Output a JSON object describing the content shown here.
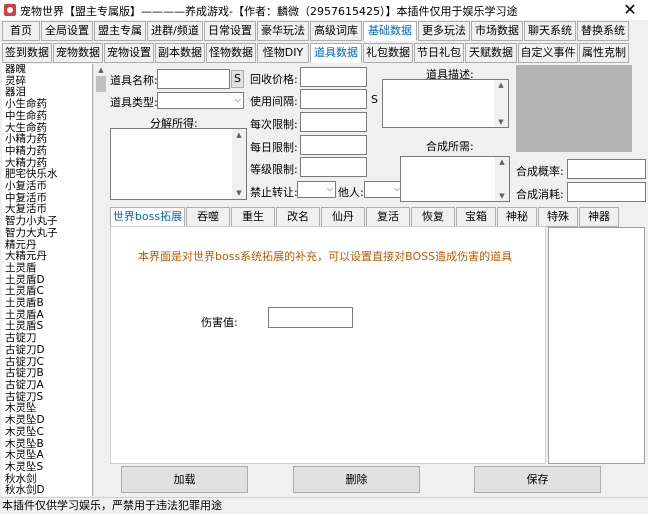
{
  "window": {
    "title": "宠物世界【盟主专属版】————养成游戏-【作者：麟微（2957615425）】本插件仅用于娱乐学习途",
    "close_glyph": "✕"
  },
  "top_tabs": [
    "首页",
    "全局设置",
    "盟主专属",
    "进群/频道",
    "日常设置",
    "豪华玩法",
    "高级词库",
    "基础数据",
    "更多玩法",
    "市场数据",
    "聊天系统",
    "替换系统"
  ],
  "second_tabs": [
    "签到数据",
    "宠物数据",
    "宠物设置",
    "副本数据",
    "怪物数据",
    "怪物DIY",
    "道具数据",
    "礼包数据",
    "节日礼包",
    "天赋数据",
    "自定义事件",
    "属性克制"
  ],
  "item_list": [
    "器魄",
    "灵碎",
    "器泪",
    "小生命药",
    "中生命药",
    "大生命药",
    "小精力药",
    "中精力药",
    "大精力药",
    "肥宅快乐水",
    "小复活币",
    "中复活币",
    "大复活币",
    "智力小丸子",
    "智力大丸子",
    "精元丹",
    "大精元丹",
    "土灵盾",
    "土灵盾D",
    "土灵盾C",
    "土灵盾B",
    "土灵盾A",
    "土灵盾S",
    "古锭刀",
    "古锭刀D",
    "古锭刀C",
    "古锭刀B",
    "古锭刀A",
    "古锭刀S",
    "木灵坠",
    "木灵坠D",
    "木灵坠C",
    "木灵坠B",
    "木灵坠A",
    "木灵坠S",
    "秋水剑",
    "秋水剑D"
  ],
  "form": {
    "item_name_label": "道具名称:",
    "s_button": "S",
    "item_type_label": "道具类型:",
    "decompose_label": "分解所得:",
    "recycle_price_label": "回收价格:",
    "use_interval_label": "使用间隔:",
    "s_suffix": "S",
    "daily_limit_label": "每次限制:",
    "per_day_limit_label": "每日限制:",
    "level_limit_label": "等级限制:",
    "forbid_transfer_label": "禁止转让:",
    "other_label": "他人:",
    "item_desc_label": "道具描述:",
    "synth_need_label": "合成所需:",
    "synth_rate_label": "合成概率:",
    "synth_cost_label": "合成消耗:"
  },
  "inner_tabs": [
    "世界boss拓展",
    "吞噬",
    "重生",
    "改名",
    "仙丹",
    "复活",
    "恢复",
    "宝箱",
    "神秘",
    "特殊",
    "神器"
  ],
  "panel": {
    "info_text": "本界面是对世界boss系统拓展的补充，可以设置直接对BOSS造成伤害的道具",
    "damage_label": "伤害值:",
    "damage_value": ""
  },
  "buttons": {
    "load": "加载",
    "delete": "删除",
    "save": "保存"
  },
  "status_bar": "本插件仅供学习娱乐，严禁用于违法犯罪用途",
  "colors": {
    "selected_tab": "#0066cc",
    "info_text": "#c05a00"
  }
}
